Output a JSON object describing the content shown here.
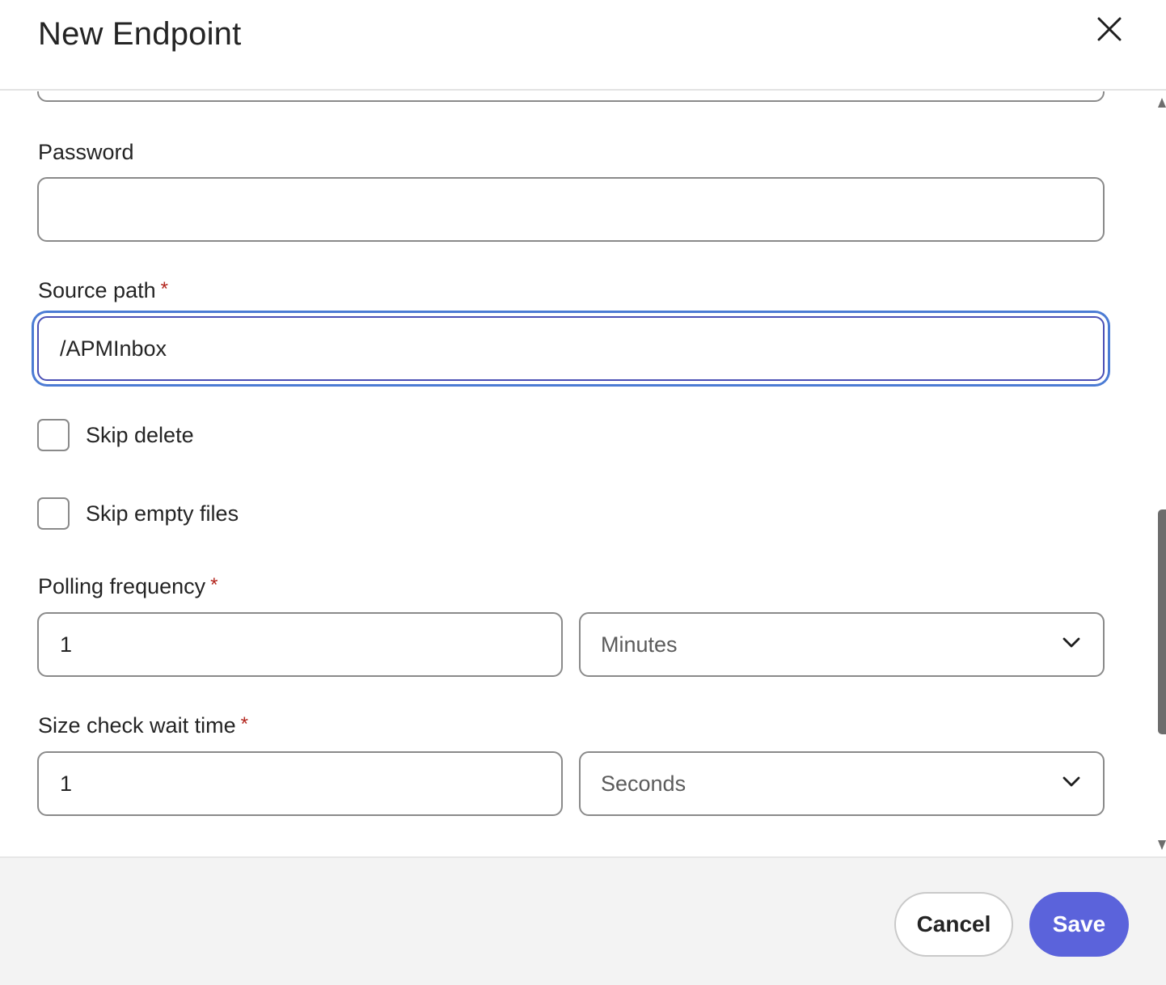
{
  "dialog": {
    "title": "New Endpoint"
  },
  "form": {
    "password": {
      "label": "Password",
      "value": ""
    },
    "source_path": {
      "label": "Source path",
      "required_mark": "*",
      "value": "/APMInbox"
    },
    "skip_delete": {
      "label": "Skip delete",
      "checked": false
    },
    "skip_empty_files": {
      "label": "Skip empty files",
      "checked": false
    },
    "polling_frequency": {
      "label": "Polling frequency",
      "required_mark": "*",
      "value": "1",
      "unit": "Minutes"
    },
    "size_check_wait_time": {
      "label": "Size check wait time",
      "required_mark": "*",
      "value": "1",
      "unit": "Seconds"
    }
  },
  "footer": {
    "cancel_label": "Cancel",
    "save_label": "Save"
  },
  "colors": {
    "accent": "#5b63db",
    "focus_ring": "#4b7bd4",
    "required": "#b3261e"
  }
}
